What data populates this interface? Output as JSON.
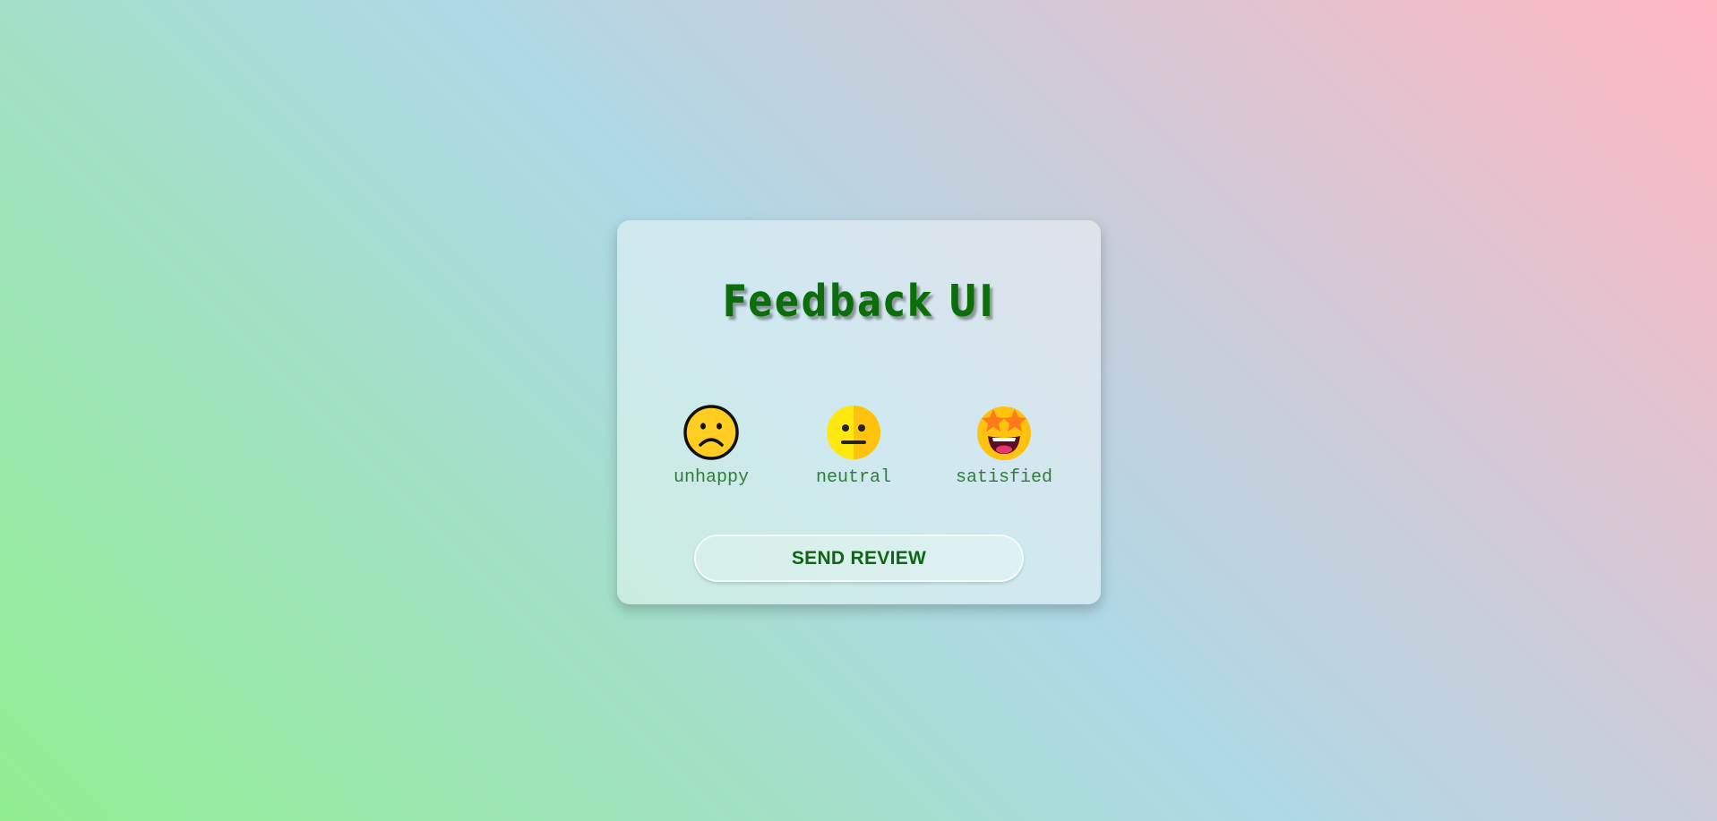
{
  "card": {
    "title": "Feedback UI",
    "ratings": [
      {
        "label": "unhappy",
        "icon": "sad-face-icon"
      },
      {
        "label": "neutral",
        "icon": "neutral-face-icon"
      },
      {
        "label": "satisfied",
        "icon": "star-struck-face-icon"
      }
    ],
    "send_button_label": "SEND REVIEW"
  },
  "colors": {
    "background_start": "#90ee90",
    "background_mid": "#add8e6",
    "background_end": "#ffb6c1",
    "title": "#0b6e0b",
    "label": "#2f7d3a",
    "button_text": "#0e6614"
  }
}
